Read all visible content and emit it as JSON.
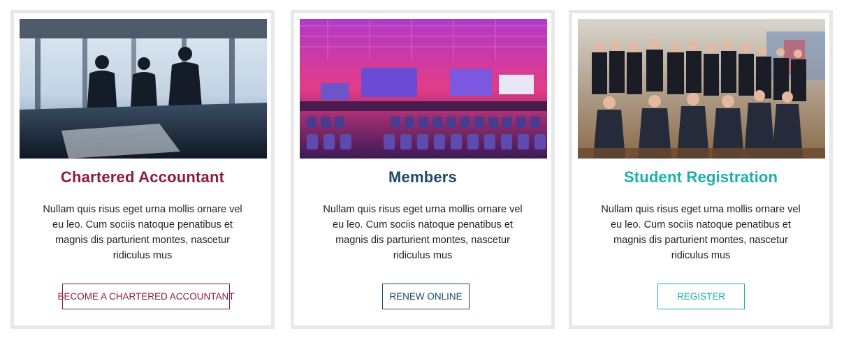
{
  "cards": [
    {
      "title": "Chartered Accountant",
      "description": "Nullam quis risus eget urna mollis ornare vel eu leo. Cum sociis natoque penatibus et magnis dis parturient montes, nascetur ridiculus mus",
      "button_label": "BECOME A CHARTERED ACCOUNTANT",
      "accent": "#8b1d3f",
      "image": "business-people-silhouette-photo"
    },
    {
      "title": "Members",
      "description": "Nullam quis risus eget urna mollis ornare vel eu leo. Cum sociis natoque penatibus et magnis dis parturient montes, nascetur ridiculus mus",
      "button_label": "RENEW ONLINE",
      "accent": "#1f4a63",
      "image": "conference-hall-photo"
    },
    {
      "title": "Student Registration",
      "description": "Nullam quis risus eget urna mollis ornare vel eu leo. Cum sociis natoque penatibus et magnis dis parturient montes, nascetur ridiculus mus",
      "button_label": "REGISTER",
      "accent": "#1bb0a8",
      "image": "student-group-photo"
    }
  ]
}
